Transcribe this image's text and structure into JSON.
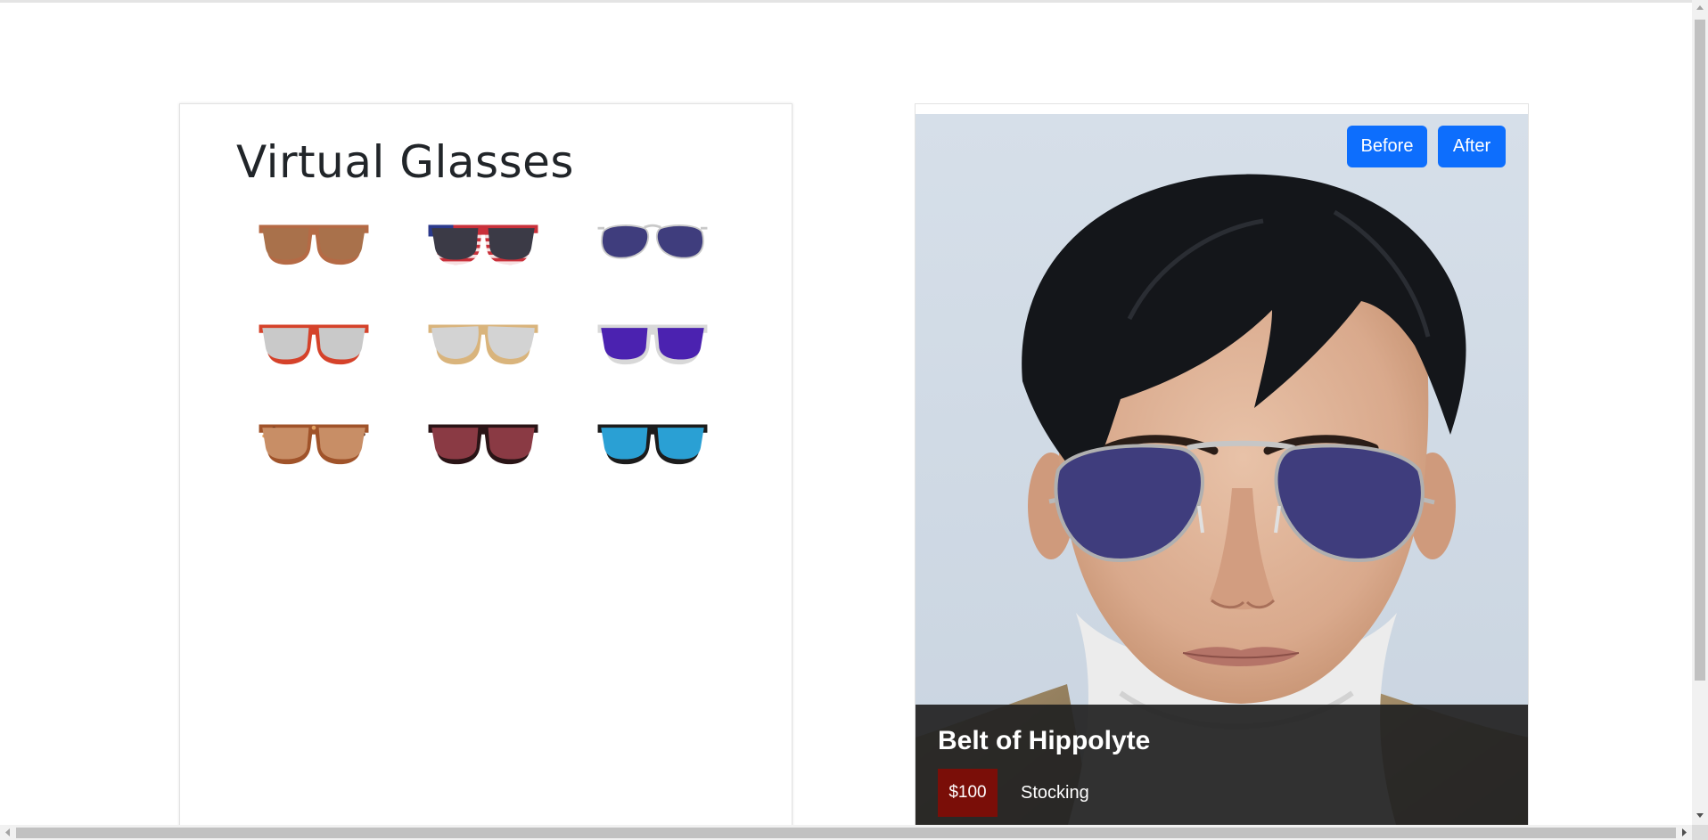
{
  "catalog": {
    "title": "Virtual Glasses",
    "glasses": [
      {
        "style": "wayfarer",
        "frame": "#b56a45",
        "lens": "#a9714b"
      },
      {
        "style": "usa-flag",
        "frame": "#c9303a",
        "lens": "#3b3a46"
      },
      {
        "style": "aviator",
        "frame": "#c9c9c9",
        "lens": "#3f3d7d"
      },
      {
        "style": "wayfarer",
        "frame": "#d5422a",
        "lens": "#c9c9c9"
      },
      {
        "style": "cat-eye",
        "frame": "#d9b47c",
        "lens": "#d3d3d3"
      },
      {
        "style": "wayfarer",
        "frame": "#d8d8d8",
        "lens": "#4b22b0"
      },
      {
        "style": "tortoise",
        "frame": "#a0532a",
        "lens": "#c88e66"
      },
      {
        "style": "wayfarer",
        "frame": "#2a1416",
        "lens": "#8a3a44"
      },
      {
        "style": "wayfarer",
        "frame": "#1c1c1c",
        "lens": "#2aa0d4"
      }
    ]
  },
  "preview": {
    "before_label": "Before",
    "after_label": "After",
    "product_name": "Belt of Hippolyte",
    "price": "$100",
    "stock_status": "Stocking",
    "colors": {
      "button": "#0d6efd",
      "price_badge": "#7a0e08",
      "overlay": "#222222",
      "tryon_lens": "#3f3d7d"
    }
  }
}
